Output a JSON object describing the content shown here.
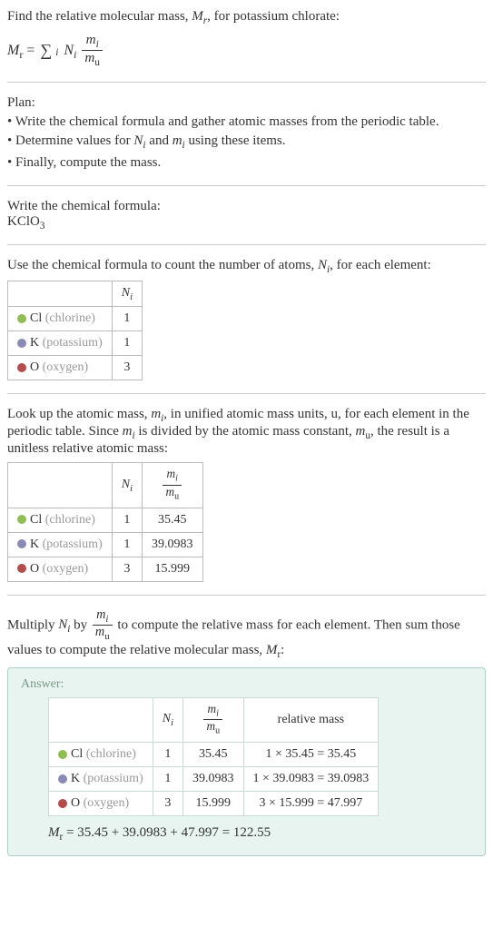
{
  "intro": {
    "line1_a": "Find the relative molecular mass, ",
    "line1_b": ", for potassium chlorate:"
  },
  "plan": {
    "header": "Plan:",
    "item1": "• Write the chemical formula and gather atomic masses from the periodic table.",
    "item2_a": "• Determine values for ",
    "item2_b": " and ",
    "item2_c": " using these items.",
    "item3": "• Finally, compute the mass."
  },
  "writeFormula": {
    "header": "Write the chemical formula:",
    "formula_base": "KClO",
    "formula_sub": "3"
  },
  "countAtoms": {
    "text_a": "Use the chemical formula to count the number of atoms, ",
    "text_b": ", for each element:"
  },
  "elements": [
    {
      "symbol": "Cl",
      "name": "(chlorine)",
      "color": "#8fbf4f",
      "n": "1",
      "m": "35.45",
      "rel": "1 × 35.45 = 35.45"
    },
    {
      "symbol": "K",
      "name": "(potassium)",
      "color": "#8a8ab8",
      "n": "1",
      "m": "39.0983",
      "rel": "1 × 39.0983 = 39.0983"
    },
    {
      "symbol": "O",
      "name": "(oxygen)",
      "color": "#b84a4a",
      "n": "3",
      "m": "15.999",
      "rel": "3 × 15.999 = 47.997"
    }
  ],
  "lookup": {
    "text_a": "Look up the atomic mass, ",
    "text_b": ", in unified atomic mass units, u, for each element in the periodic table. Since ",
    "text_c": " is divided by the atomic mass constant, ",
    "text_d": ", the result is a unitless relative atomic mass:"
  },
  "multiply": {
    "text_a": "Multiply ",
    "text_b": " by ",
    "text_c": " to compute the relative mass for each element. Then sum those values to compute the relative molecular mass, ",
    "text_d": ":"
  },
  "answer": {
    "title": "Answer:",
    "rel_header": "relative mass",
    "final": " = 35.45 + 39.0983 + 47.997 = 122.55"
  },
  "sym": {
    "Mr": "M",
    "r": "r",
    "N": "N",
    "i": "i",
    "m": "m",
    "u": "u"
  }
}
